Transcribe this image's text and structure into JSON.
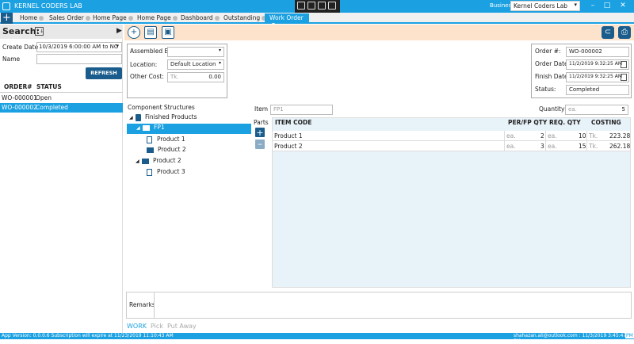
{
  "app": {
    "title": "KERNEL CODERS LAB",
    "business_label": "Business:",
    "business_value": "Kernel Coders Lab"
  },
  "tabs": [
    {
      "label": "Home"
    },
    {
      "label": "Sales Order"
    },
    {
      "label": "Home Page"
    },
    {
      "label": "Home Page"
    },
    {
      "label": "Dashboard"
    },
    {
      "label": "Outstanding"
    },
    {
      "label": "Work Order"
    }
  ],
  "left": {
    "search_title": "Search:",
    "create_date_label": "Create Date",
    "create_date_value": "10/3/2019 6:00:00 AM to NO",
    "name_label": "Name",
    "name_value": "",
    "refresh_label": "REFRESH",
    "col_order": "ORDER#",
    "col_status": "STATUS",
    "rows": [
      {
        "order": "WO-000001",
        "status": "Open"
      },
      {
        "order": "WO-000002",
        "status": "Completed"
      }
    ]
  },
  "assembly": {
    "assembled_by_label": "Assembled By",
    "assembled_by_value": "",
    "location_label": "Location:",
    "location_value": "Default Location",
    "other_cost_label": "Other Cost:",
    "other_cost_unit": "Tk.",
    "other_cost_value": "0.00"
  },
  "order": {
    "order_no_label": "Order #:",
    "order_no_value": "WO-000002",
    "order_date_label": "Order Date:",
    "order_date_value": "11/2/2019 9:32:25 AM",
    "finish_date_label": "Finish Date:",
    "finish_date_value": "11/2/2019 9:32:25 AM",
    "status_label": "Status:",
    "status_value": "Completed"
  },
  "tree": {
    "title": "Component Structures",
    "root": "Finished Products",
    "fp1": "FP1",
    "fp1_children": [
      "Product 1",
      "Product 2"
    ],
    "product2": "Product 2",
    "product2_children": [
      "Product 3"
    ]
  },
  "item": {
    "item_label": "Item",
    "item_value": "FP1",
    "quantity_label": "Quantity",
    "quantity_unit": "ea.",
    "quantity_value": "5",
    "parts_label": "Parts"
  },
  "grid": {
    "headers": {
      "code": "ITEM CODE",
      "per": "PER/FP QTY",
      "req": "REQ. QTY",
      "costing": "COSTING"
    },
    "rows": [
      {
        "code": "Product 1",
        "per_unit": "ea.",
        "per": "2",
        "req_unit": "ea.",
        "req": "10",
        "cost_unit": "Tk.",
        "cost": "223.28"
      },
      {
        "code": "Product 2",
        "per_unit": "ea.",
        "per": "3",
        "req_unit": "ea.",
        "req": "15",
        "cost_unit": "Tk.",
        "cost": "262.18"
      }
    ]
  },
  "remarks_label": "Remarks",
  "bottom_tabs": [
    "WORK",
    "Pick",
    "Put Away"
  ],
  "status": {
    "left": "App Version: 0.0.0.6   Subscription will expire at 11/23/2019 11:10:43 AM",
    "right": "shahazan.ali@outlook.com : 11/3/2019 3:45:47 PM",
    "badge": "PM"
  },
  "colors": {
    "accent": "#1ba1e2",
    "dark": "#1a5c8c",
    "toolbar_bg": "#fde3cb"
  }
}
